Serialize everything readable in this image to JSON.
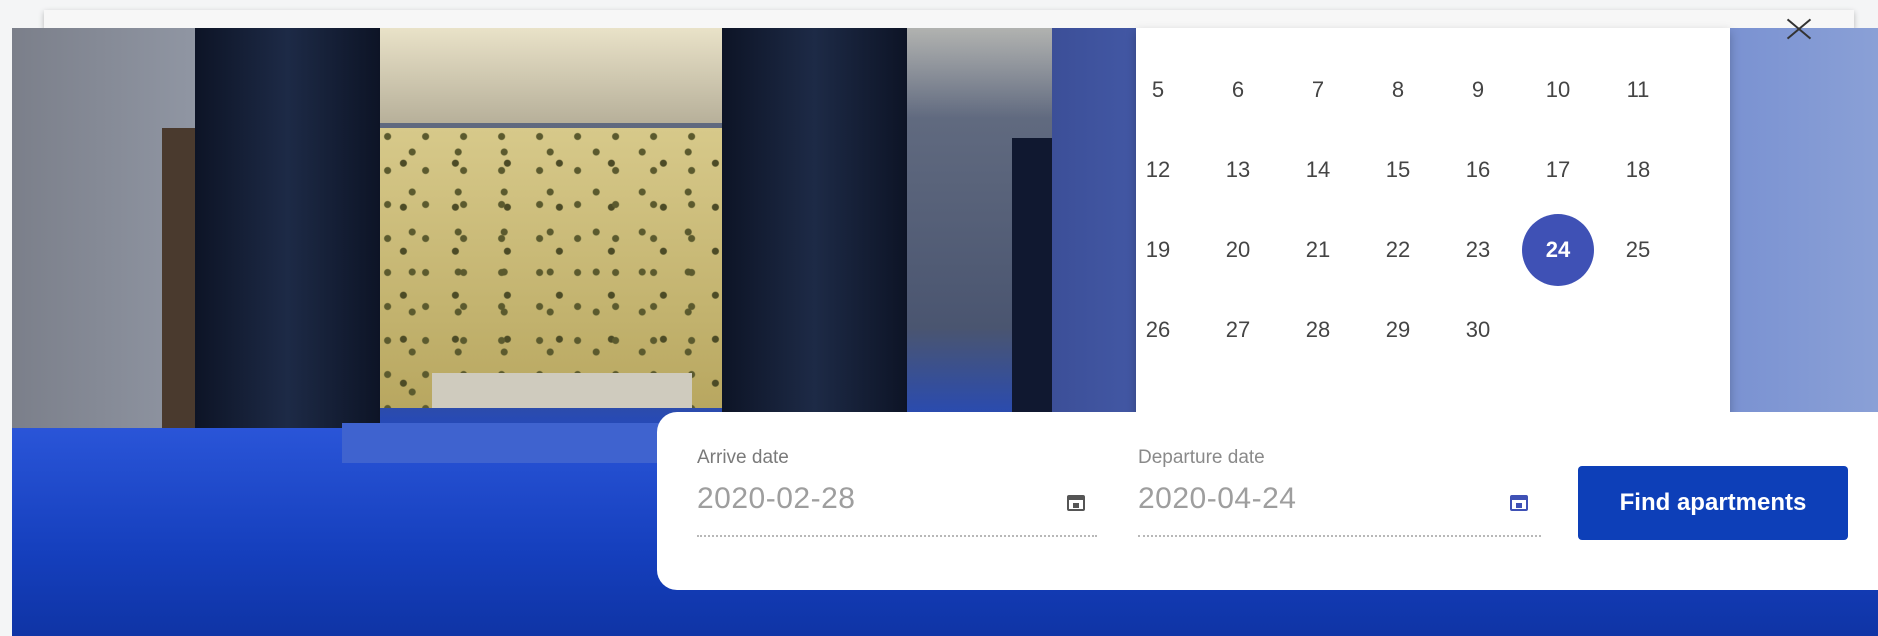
{
  "calendar": {
    "weeks": [
      [
        "5",
        "6",
        "7",
        "8",
        "9",
        "10",
        "11"
      ],
      [
        "12",
        "13",
        "14",
        "15",
        "16",
        "17",
        "18"
      ],
      [
        "19",
        "20",
        "21",
        "22",
        "23",
        "24",
        "25"
      ],
      [
        "26",
        "27",
        "28",
        "29",
        "30",
        "",
        ""
      ]
    ],
    "selected_day": "24",
    "accent_color": "#3f51b5"
  },
  "search": {
    "arrive_label": "Arrive date",
    "arrive_value": "2020-02-28",
    "departure_label": "Departure date",
    "departure_value": "2020-04-24",
    "find_label": "Find apartments",
    "button_color": "#0d3fb8"
  },
  "icons": {
    "close": "close-icon",
    "calendar": "calendar-icon"
  }
}
